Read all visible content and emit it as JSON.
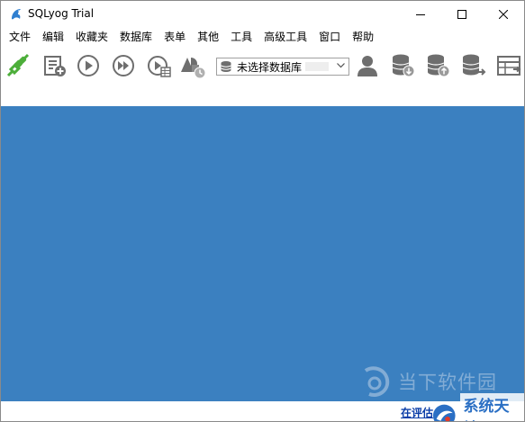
{
  "window": {
    "title": "SQLyog Trial"
  },
  "menu": [
    {
      "label": "文件"
    },
    {
      "label": "编辑"
    },
    {
      "label": "收藏夹"
    },
    {
      "label": "数据库"
    },
    {
      "label": "表单"
    },
    {
      "label": "其他"
    },
    {
      "label": "工具"
    },
    {
      "label": "高级工具"
    },
    {
      "label": "窗口"
    },
    {
      "label": "帮助"
    }
  ],
  "toolbar": {
    "icons": [
      "connect-icon",
      "new-query-icon",
      "execute-icon",
      "execute-all-icon",
      "execute-edit-icon",
      "shapes-icon",
      "user-icon",
      "backup-icon",
      "restore-icon",
      "sync-icon",
      "table-schema-icon"
    ],
    "database_select": {
      "value": "未选择数据库"
    }
  },
  "status": {
    "link_text": "在评估"
  },
  "watermark": {
    "site_large": "当下软件园",
    "site_small": "系统天地"
  },
  "colors": {
    "workspace": "#3b80c0",
    "connect_green": "#4cae3a",
    "icon_gray": "#6e6e6e",
    "link_blue": "#0b3ea8"
  }
}
